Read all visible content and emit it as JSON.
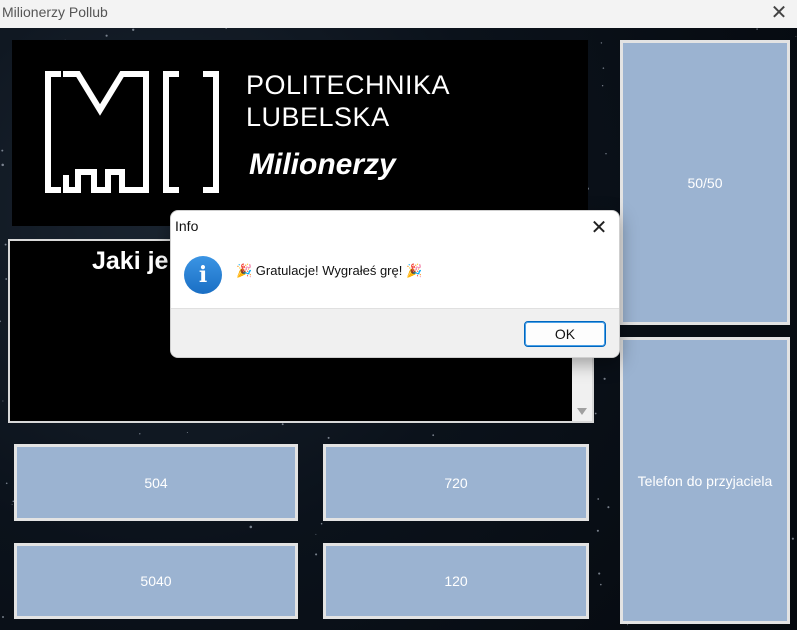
{
  "window": {
    "title": "Milionerzy Pollub",
    "close_glyph": "✕"
  },
  "logo": {
    "line1": "POLITECHNIKA",
    "line2": "LUBELSKA",
    "tagline": "Milionerzy"
  },
  "question": {
    "visible_text": "Jaki je"
  },
  "answers": [
    {
      "label": "504"
    },
    {
      "label": "720"
    },
    {
      "label": "5040"
    },
    {
      "label": "120"
    }
  ],
  "lifelines": {
    "fifty_fifty": "50/50",
    "phone": "Telefon do przyjaciela"
  },
  "dialog": {
    "title": "Info",
    "close_glyph": "✕",
    "icon": "info-icon",
    "message": "🎉 Gratulacje! Wygrałeś grę! 🎉",
    "ok_label": "OK"
  },
  "colors": {
    "button_fill": "#9bb3d1",
    "button_border": "#e3e3e3",
    "dialog_accent": "#0067c0",
    "info_icon": "#1a6fc4"
  }
}
